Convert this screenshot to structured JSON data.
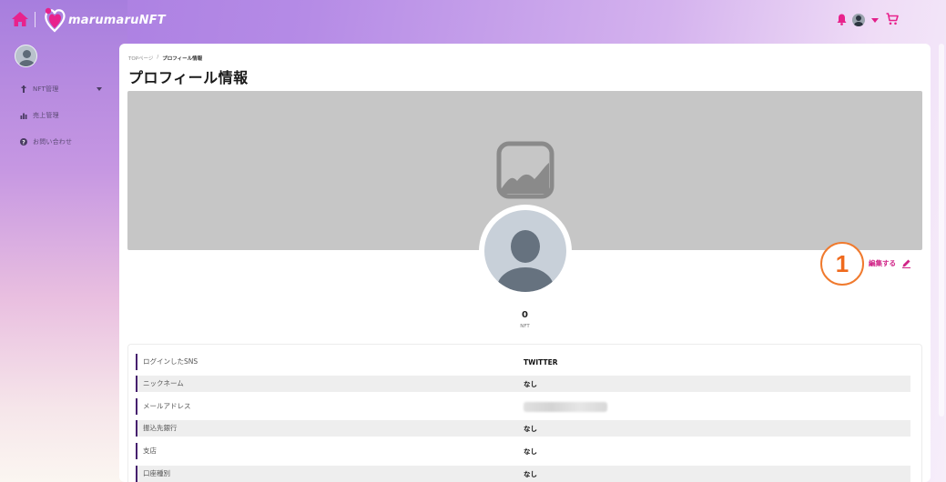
{
  "header": {
    "logo_text": "marumaruNFT",
    "icons": [
      "home-icon",
      "bell-icon",
      "user-avatar",
      "caret-down",
      "cart-icon"
    ]
  },
  "sidebar": {
    "items": [
      {
        "label": "NFT管理",
        "icon": "nft-icon",
        "has_caret": true
      },
      {
        "label": "売上管理",
        "icon": "chart-icon",
        "has_caret": false
      },
      {
        "label": "お問い合わせ",
        "icon": "question-icon",
        "has_caret": false
      }
    ]
  },
  "breadcrumb": {
    "home": "TOPページ",
    "separator": "/",
    "current": "プロフィール情報"
  },
  "page": {
    "title": "プロフィール情報",
    "edit_label": "編集する",
    "callout_number": "1",
    "nft_count": "0",
    "nft_label": "NFT"
  },
  "profile_rows": [
    {
      "label": "ログインしたSNS",
      "value": "TWITTER",
      "blurred": false
    },
    {
      "label": "ニックネーム",
      "value": "なし",
      "blurred": false
    },
    {
      "label": "メールアドレス",
      "value": "",
      "blurred": true
    },
    {
      "label": "振込先銀行",
      "value": "なし",
      "blurred": false
    },
    {
      "label": "支店",
      "value": "なし",
      "blurred": false
    },
    {
      "label": "口座種別",
      "value": "なし",
      "blurred": false
    }
  ],
  "colors": {
    "accent": "#d02487",
    "callout": "#ef6a1d",
    "row_marker": "#46206e"
  }
}
